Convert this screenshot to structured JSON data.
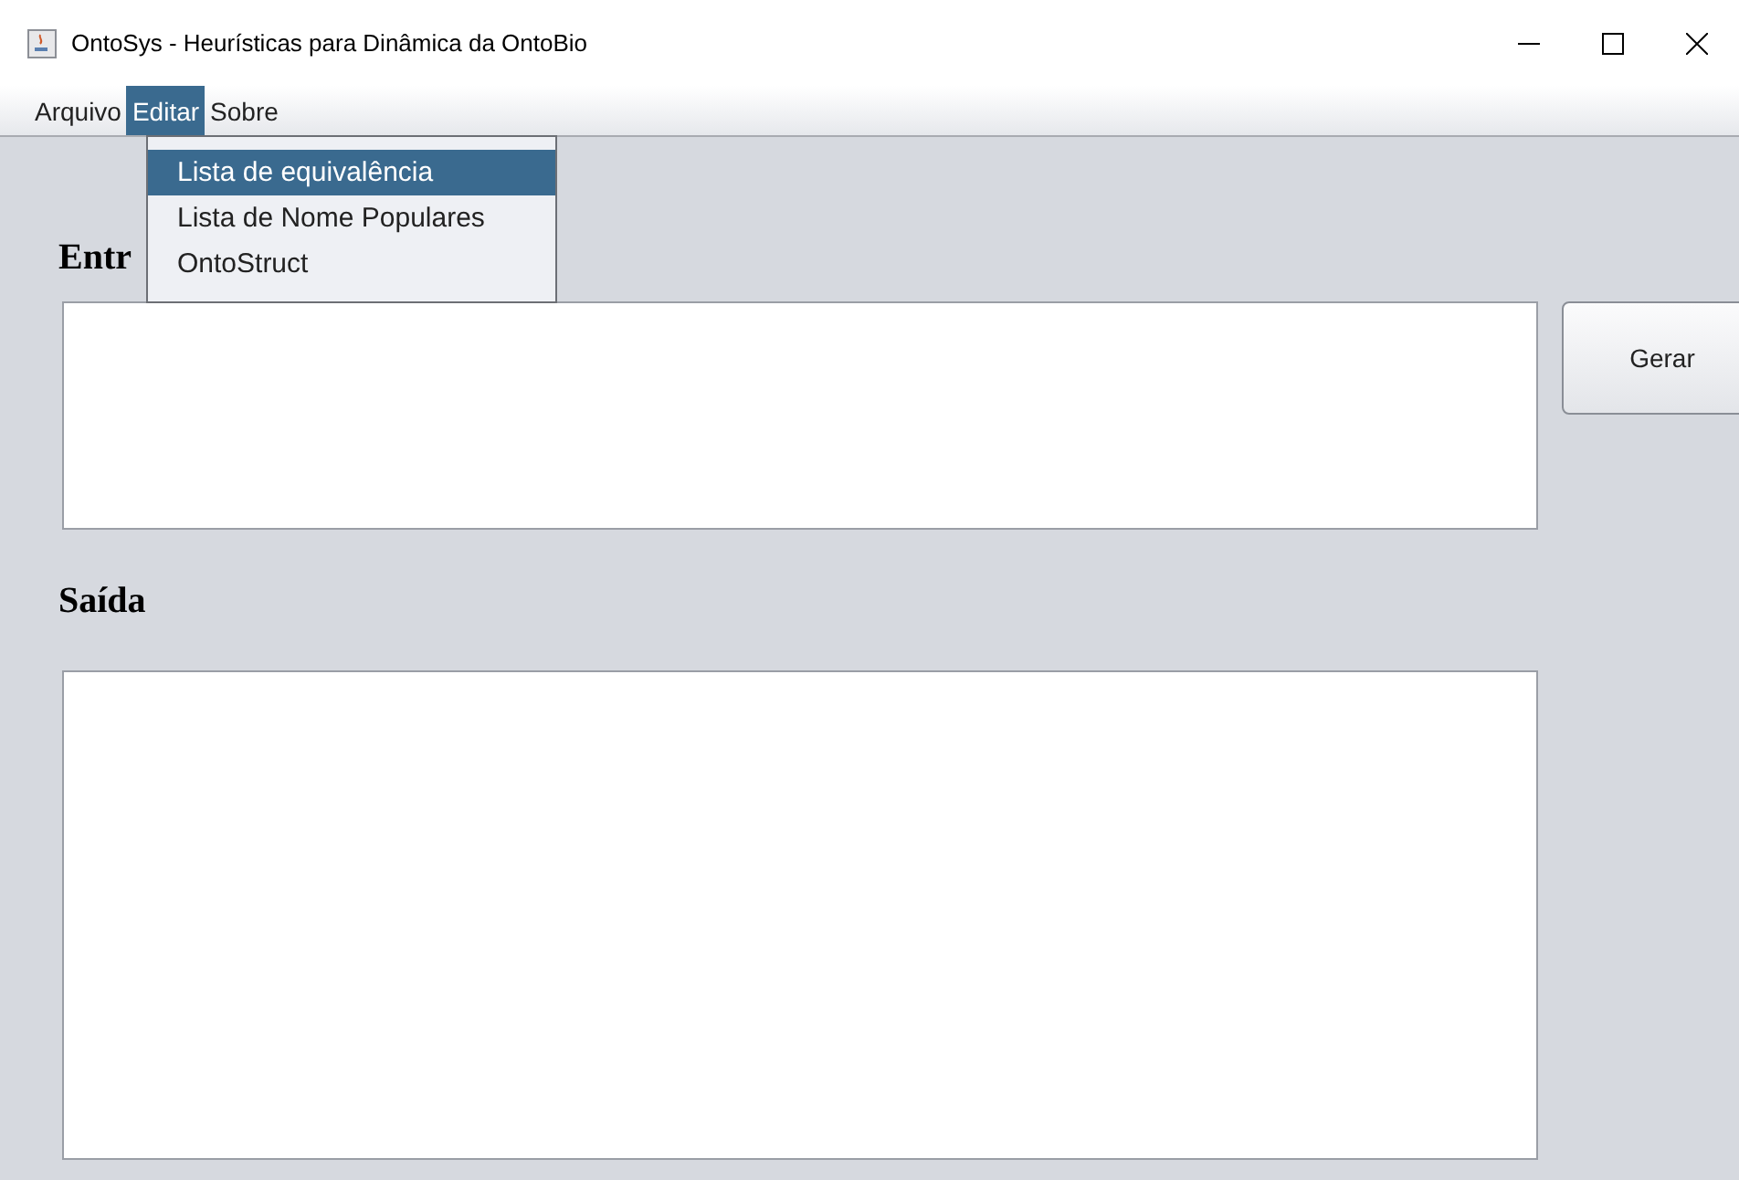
{
  "window": {
    "title": "OntoSys - Heurísticas para Dinâmica da OntoBio"
  },
  "menu_bar": [
    {
      "label": "Arquivo",
      "selected": false
    },
    {
      "label": "Editar",
      "selected": true
    },
    {
      "label": "Sobre",
      "selected": false
    }
  ],
  "open_menu": {
    "items": [
      {
        "label": "Lista de equivalência",
        "selected": true
      },
      {
        "label": "Lista de Nome Populares",
        "selected": false
      },
      {
        "label": "OntoStruct",
        "selected": false
      }
    ]
  },
  "input": {
    "label": "Entr"
  },
  "generate_button": "Gerar",
  "output": {
    "label": "Saída"
  }
}
